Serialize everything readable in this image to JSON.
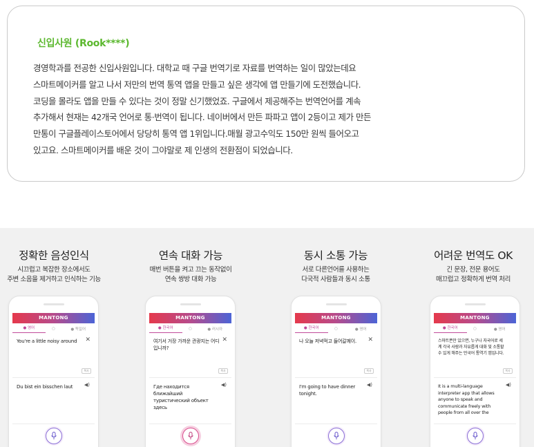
{
  "testimonial": {
    "name": "신입사원 (Rook****)",
    "lines": [
      "경영학과를 전공한 신입사원입니다. 대학교 때 구글 번역기로 자료를 번역하는 일이 많았는데요",
      "스마트메이커를 알고 나서 저만의 번역 통역 앱을 만들고 싶은 생각에 앱 만들기에 도전했습니다.",
      "코딩을 몰라도 앱을 만들 수 있다는 것이 정말 신기했었죠. 구글에서 제공해주는 번역언어를 계속",
      "추가해서 현재는 42개국 언어로 통·번역이 됩니다. 네이버에서 만든 파파고 앱이 2등이고 제가 만든",
      "만통이 구글플레이스토어에서 당당히 통역 앱 1위입니다.매월 광고수익도 150만 원씩 들어오고",
      "있고요. 스마트메이커를 배운 것이 그야말로 제 인생의 전환점이 되었습니다."
    ]
  },
  "features": [
    {
      "title": "정확한 음성인식",
      "desc1": "시끄럽고 복잡한 장소에서도",
      "desc2": "주변 소음을 제거하고 인식하는 기능",
      "app_name": "MANTONG",
      "tab_left": "● 영어",
      "tab_mid": "○",
      "tab_right": "● 독일어",
      "source_text": "You're a little noisy around",
      "translated_text": "Du bist ein bisschen laut",
      "mic_active": false
    },
    {
      "title": "연속 대화 가능",
      "desc1": "매번 버튼을 켜고 끄는 동작없이",
      "desc2": "연속 쌍방 대화 가능",
      "app_name": "MANTONG",
      "tab_left": "● 한국어",
      "tab_mid": "○",
      "tab_right": "● 러시아",
      "source_text": "여기서 거장 가까운 관광지는 어디입니까?",
      "translated_text": "Где находится ближайший туристический объект здесь",
      "mic_active": true
    },
    {
      "title": "동시 소통 가능",
      "desc1": "서로 다른언어를 사용하는",
      "desc2": "다국적 사람들과 동시 소통",
      "app_name": "MANTONG",
      "tab_left": "● 한국어",
      "tab_mid": "○",
      "tab_right": "● 영어",
      "source_text": "나 오늘 저녁먹고 들어갈께이.",
      "translated_text": "I'm going to have dinner tonight.",
      "mic_active": false
    },
    {
      "title": "어려운 번역도 OK",
      "desc1": "긴 문장, 전문 용어도",
      "desc2": "매끄럽고 정확하게 번역 처리",
      "app_name": "MANTONG",
      "tab_left": "● 한국어",
      "tab_mid": "○",
      "tab_right": "● 영어",
      "source_text": "스마트폰만 있으면, 누구나 자국어로 세계 각국 사람과 자유롭게 대화 및 소통할 수 있게 해주는 만국어 통역기 앱입니다.",
      "translated_text": "It is a multi-language interpreter app that allows anyone to speak and communicate freely with people from all over the",
      "mic_active": false
    }
  ],
  "copy_label": "복사",
  "speaker_glyph": "◀)",
  "close_glyph": "✕"
}
